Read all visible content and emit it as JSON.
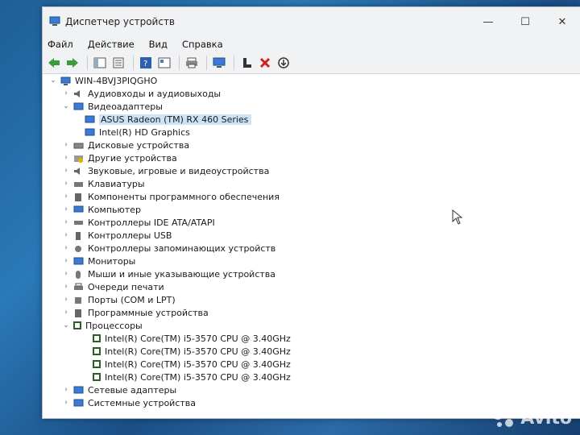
{
  "window": {
    "title": "Диспетчер устройств"
  },
  "menu": [
    "Файл",
    "Действие",
    "Вид",
    "Справка"
  ],
  "tree": {
    "root": "WIN-4BVJ3PIQGHO",
    "items": [
      "Аудиовходы и аудиовыходы",
      "Видеоадаптеры",
      "ASUS Radeon (TM) RX 460 Series",
      "Intel(R) HD Graphics",
      "Дисковые устройства",
      "Другие устройства",
      "Звуковые, игровые и видеоустройства",
      "Клавиатуры",
      "Компоненты программного обеспечения",
      "Компьютер",
      "Контроллеры IDE ATA/ATAPI",
      "Контроллеры USB",
      "Контроллеры запоминающих устройств",
      "Мониторы",
      "Мыши и иные указывающие устройства",
      "Очереди печати",
      "Порты (COM и LPT)",
      "Программные устройства",
      "Процессоры",
      "Intel(R) Core(TM) i5-3570 CPU @ 3.40GHz",
      "Intel(R) Core(TM) i5-3570 CPU @ 3.40GHz",
      "Intel(R) Core(TM) i5-3570 CPU @ 3.40GHz",
      "Intel(R) Core(TM) i5-3570 CPU @ 3.40GHz",
      "Сетевые адаптеры",
      "Системные устройства"
    ]
  },
  "watermark": {
    "text": "Avito"
  },
  "colors": {
    "selection": "#cce4f7",
    "desktop": "#1e5f97"
  }
}
